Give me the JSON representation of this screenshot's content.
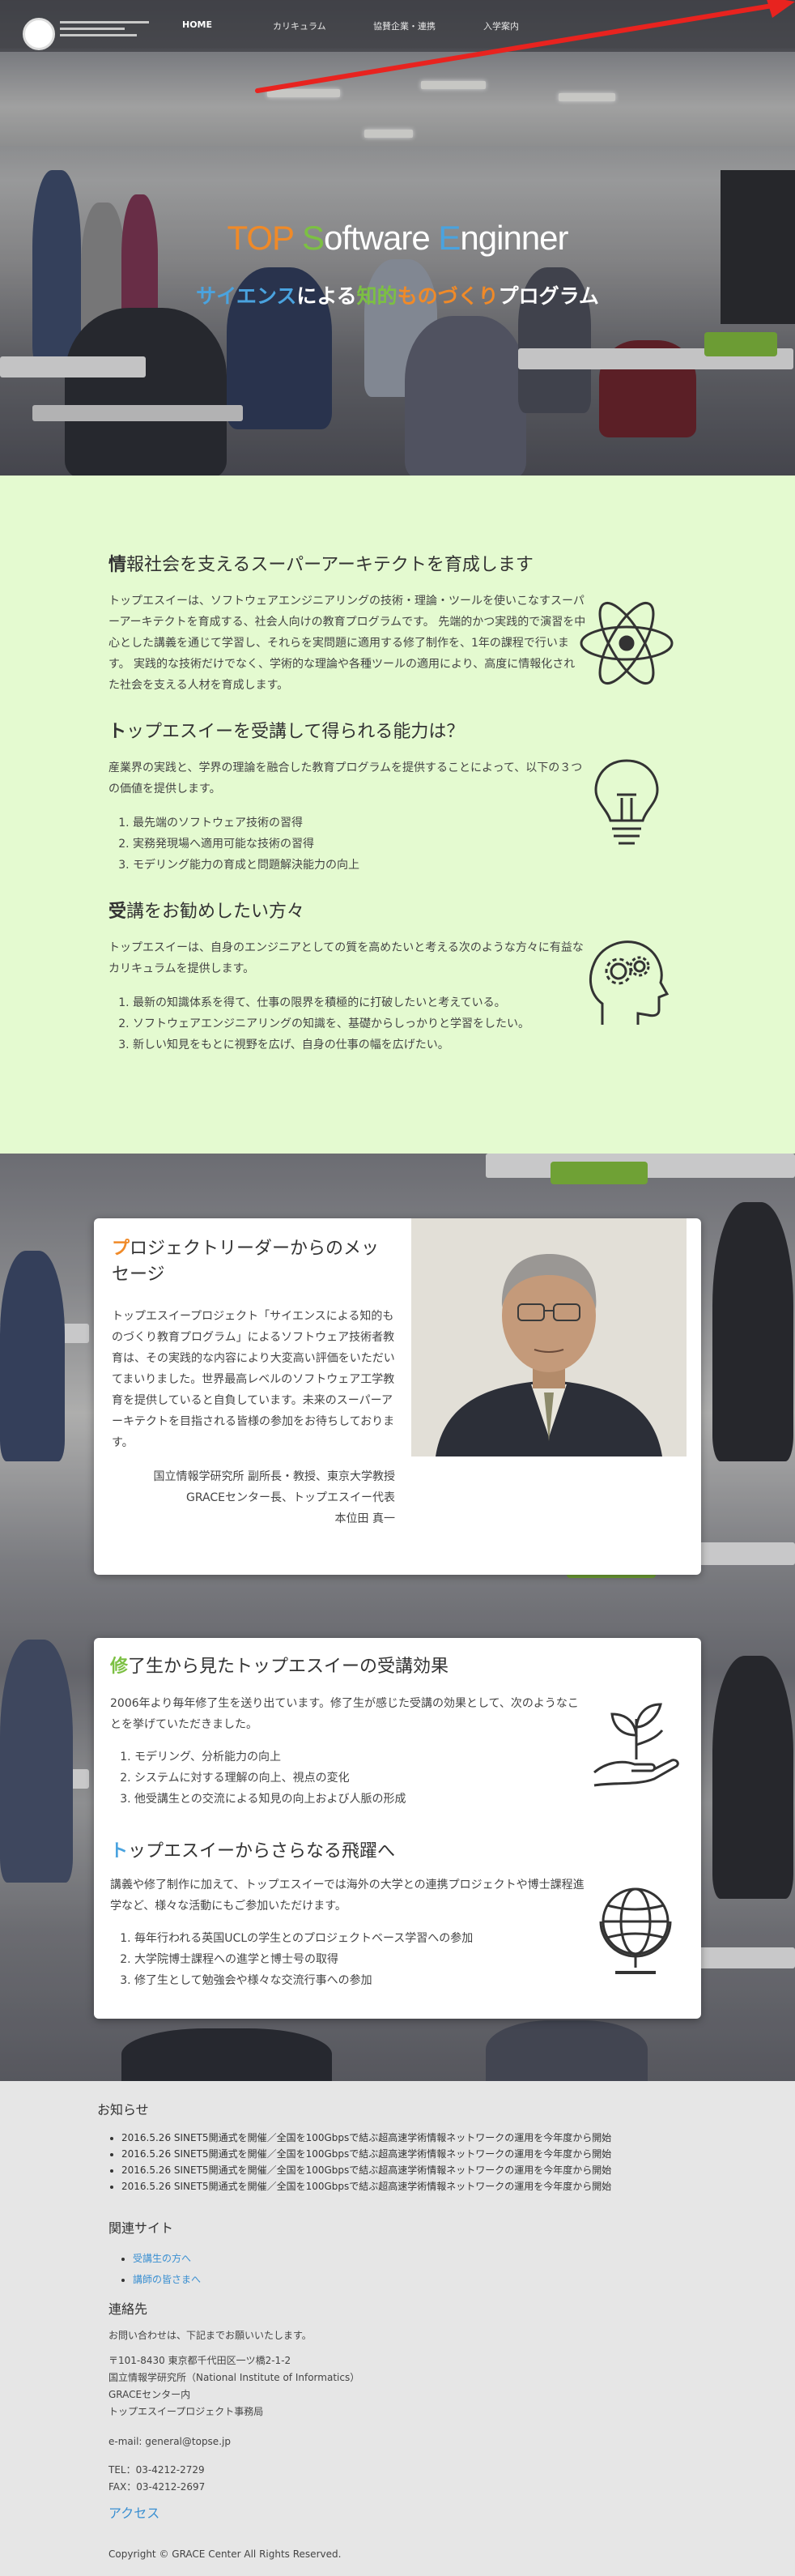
{
  "nav": {
    "items": [
      {
        "label": "HOME",
        "active": true
      },
      {
        "label": "カリキュラム",
        "active": false
      },
      {
        "label": "協賛企業・連携",
        "active": false
      },
      {
        "label": "入学案内",
        "active": false
      }
    ]
  },
  "hero": {
    "title_parts": [
      "TOP",
      " ",
      "S",
      "oftware ",
      "E",
      "nginner"
    ],
    "subtitle_parts": [
      "サイエンス",
      "による",
      "知的",
      "もの",
      "づくり",
      "プログラム"
    ]
  },
  "intro": {
    "s1": {
      "title_first": "情",
      "title_rest": "報社会を支えるスーパーアーキテクトを育成します",
      "body": "トップエスイーは、ソフトウェアエンジニアリングの技術・理論・ツールを使いこなすスーパーアーキテクトを育成する、社会人向けの教育プログラムです。 先端的かつ実践的で演習を中心とした講義を通じて学習し、それらを実問題に適用する修了制作を、1年の課程で行います。 実践的な技術だけでなく、学術的な理論や各種ツールの適用により、高度に情報化された社会を支える人材を育成します。",
      "icon": "atom-icon"
    },
    "s2": {
      "title_first": "ト",
      "title_rest": "ップエスイーを受講して得られる能力は？",
      "body": "産業界の実践と、学界の理論を融合した教育プログラムを提供することによって、以下の３つの価値を提供します。",
      "items": [
        "最先端のソフトウェア技術の習得",
        "実務発現場へ適用可能な技術の習得",
        "モデリング能力の育成と問題解決能力の向上"
      ],
      "icon": "lightbulb-icon"
    },
    "s3": {
      "title_first": "受",
      "title_rest": "講をお勧めしたい方々",
      "body": "トップエスイーは、自身のエンジニアとしての質を高めたいと考える次のような方々に有益なカリキュラムを提供します。",
      "items": [
        "最新の知識体系を得て、仕事の限界を積極的に打破したいと考えている。",
        "ソフトウェアエンジニアリングの知識を、基礎からしっかりと学習をしたい。",
        "新しい知見をもとに視野を広げ、自身の仕事の幅を広げたい。"
      ],
      "icon": "head-gears-icon"
    }
  },
  "message": {
    "title_first": "プ",
    "title_rest": "ロジェクトリーダーからのメッセージ",
    "body": "トップエスイープロジェクト「サイエンスによる知的ものづくり教育プログラム」によるソフトウェア技術者教育は、その実践的な内容により大変高い評価をいただいてまいりました。世界最高レベルのソフトウェア工学教育を提供していると自負しています。未来のスーパーアーキテクトを目指される皆様の参加をお待ちしております。",
    "sig1": "国立情報学研究所 副所長・教授、東京大学教授",
    "sig2": "GRACEセンター長、トップエスイー代表",
    "sig3": "本位田 真一"
  },
  "effects": {
    "title_first": "修",
    "title_rest": "了生から見たトップエスイーの受講効果",
    "body": "2006年より毎年修了生を送り出ています。修了生が感じた受講の効果として、次のようなことを挙げていただきました。",
    "items": [
      "モデリング、分析能力の向上",
      "システムに対する理解の向上、視点の変化",
      "他受講生との交流による知見の向上および人脈の形成"
    ],
    "icon": "plant-hand-icon"
  },
  "leap": {
    "title_first": "ト",
    "title_rest": "ップエスイーからさらなる飛躍へ",
    "body": "講義や修了制作に加えて、トップエスイーでは海外の大学との連携プロジェクトや博士課程進学など、様々な活動にもご参加いただけます。",
    "items": [
      "毎年行われる英国UCLの学生とのプロジェクトベース学習への参加",
      "大学院博士課程への進学と博士号の取得",
      "修了生として勉強会や様々な交流行事への参加"
    ],
    "icon": "globe-icon"
  },
  "footer": {
    "news_title": "お知らせ",
    "news": [
      "2016.5.26 SINET5開通式を開催／全国を100Gbpsで結ぶ超高速学術情報ネットワークの運用を今年度から開始",
      "2016.5.26 SINET5開通式を開催／全国を100Gbpsで結ぶ超高速学術情報ネットワークの運用を今年度から開始",
      "2016.5.26 SINET5開通式を開催／全国を100Gbpsで結ぶ超高速学術情報ネットワークの運用を今年度から開始",
      "2016.5.26 SINET5開通式を開催／全国を100Gbpsで結ぶ超高速学術情報ネットワークの運用を今年度から開始"
    ],
    "related_title": "関連サイト",
    "related": [
      "受講生の方へ",
      "講師の皆さまへ"
    ],
    "contact_title": "連絡先",
    "contact_intro": "お問い合わせは、下記までお願いいたします。",
    "addr1": "〒101-8430 東京都千代田区一ツ橋2-1-2",
    "addr2": "国立情報学研究所（National Institute of Informatics）",
    "addr3": "GRACEセンター内",
    "addr4": "トップエスイープロジェクト事務局",
    "email": "e-mail: general@topse.jp",
    "tel": "TEL：03-4212-2729",
    "fax": "FAX：03-4212-2697",
    "access": "アクセス",
    "copyright": "Copyright © GRACE Center All Rights Reserved."
  },
  "colors": {
    "orange": "#f08a28",
    "green": "#7cc043",
    "blue": "#4aa3df",
    "intro_bg": "#e4fad0",
    "arrow": "#e8231f"
  }
}
